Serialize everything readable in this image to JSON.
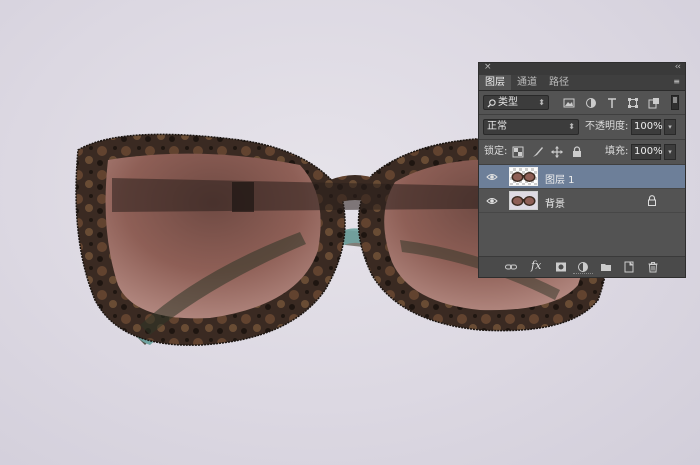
{
  "panel": {
    "close_glyph": "×",
    "collapse_glyph": "‹‹",
    "tabs": [
      {
        "label": "图层",
        "active": true
      },
      {
        "label": "通道",
        "active": false
      },
      {
        "label": "路径",
        "active": false
      }
    ],
    "menu_glyph": "≡",
    "filter": {
      "label": "类型",
      "icon": "search-icon"
    },
    "filter_icons": [
      "image-filter-icon",
      "adjustment-filter-icon",
      "type-filter-icon",
      "shape-filter-icon",
      "smart-object-filter-icon"
    ],
    "blend_mode": "正常",
    "opacity_label": "不透明度:",
    "opacity_value": "100%",
    "lock_label": "锁定:",
    "lock_icons": [
      "lock-transparent-icon",
      "lock-image-icon",
      "lock-position-icon",
      "lock-all-icon"
    ],
    "fill_label": "填充:",
    "fill_value": "100%",
    "layers": [
      {
        "name": "图层 1",
        "selected": true,
        "visible": true,
        "locked": false,
        "transparent_thumb": true
      },
      {
        "name": "背景",
        "selected": false,
        "visible": true,
        "locked": true,
        "transparent_thumb": false
      }
    ],
    "footer_icons": [
      "link-icon",
      "fx-icon",
      "mask-icon",
      "adjustment-icon",
      "folder-icon",
      "new-layer-icon",
      "trash-icon"
    ],
    "fx_label": "fx"
  },
  "colors": {
    "panel_bg": "#535353",
    "selected_layer": "#6d7f99",
    "background": "#dedae3",
    "frame_tortoise": "#3b2a20",
    "lens": "#8a5c50",
    "temple_tip": "#6fa3a0"
  }
}
